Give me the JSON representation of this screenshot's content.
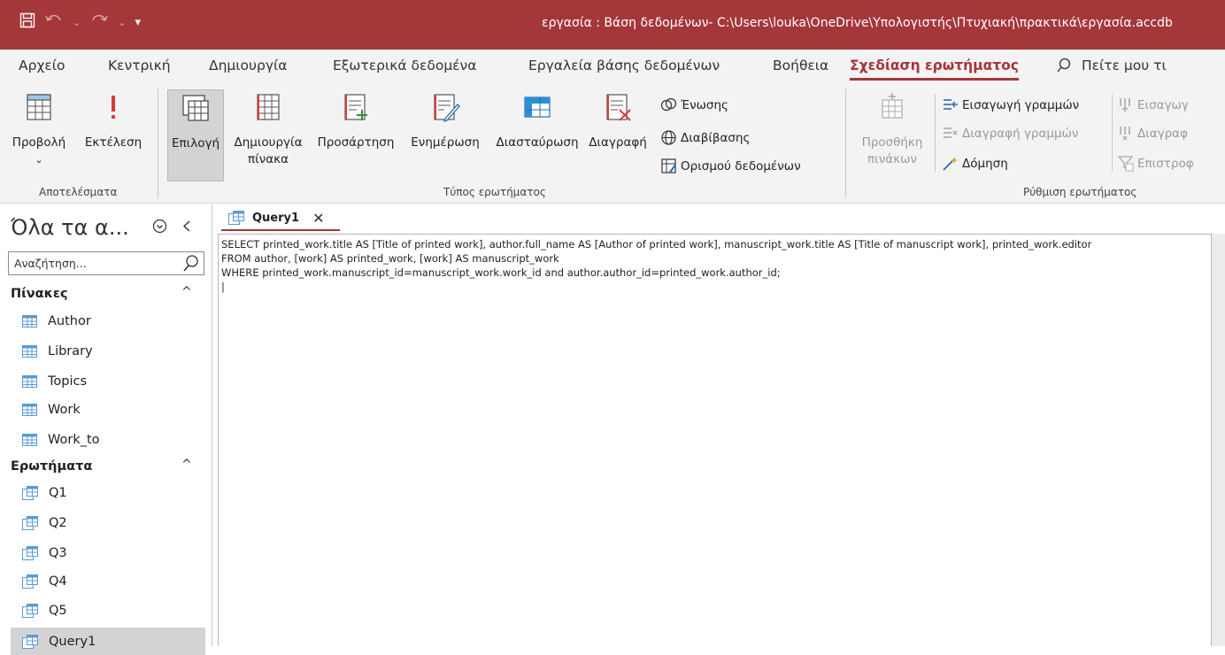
{
  "titlebar": {
    "title": "εργασία : Βάση δεδομένων- C:\\Users\\louka\\OneDrive\\Υπολογιστής\\Πτυχιακή\\πρακτικά\\εργασία.accdb"
  },
  "tabs": [
    {
      "label": "Αρχείο"
    },
    {
      "label": "Κεντρική"
    },
    {
      "label": "Δημιουργία"
    },
    {
      "label": "Εξωτερικά δεδομένα"
    },
    {
      "label": "Εργαλεία βάσης δεδομένων"
    },
    {
      "label": "Βοήθεια"
    },
    {
      "label": "Σχεδίαση ερωτήματος"
    }
  ],
  "tellme": "Πείτε μου τι",
  "ribbon": {
    "results": {
      "label": "Αποτελέσματα",
      "view": "Προβολή",
      "run": "Εκτέλεση"
    },
    "query_type": {
      "label": "Τύπος ερωτήματος",
      "select": "Επιλογή",
      "make_table_1": "Δημιουργία",
      "make_table_2": "πίνακα",
      "append": "Προσάρτηση",
      "update": "Ενημέρωση",
      "crosstab": "Διασταύρωση",
      "delete": "Διαγραφή",
      "union": "Ένωσης",
      "passthrough": "Διαβίβασης",
      "data_definition": "Ορισμού δεδομένων"
    },
    "query_setup": {
      "label": "Ρύθμιση ερωτήματος",
      "add_tables_1": "Προσθήκη",
      "add_tables_2": "πινάκων",
      "insert_rows": "Εισαγωγή γραμμών",
      "delete_rows": "Διαγραφή γραμμών",
      "builder": "Δόμηση",
      "insert_cols": "Εισαγωγ",
      "delete_cols": "Διαγραφ",
      "return": "Επιστροφ"
    }
  },
  "nav": {
    "header": "Όλα τα α...",
    "search_placeholder": "Αναζήτηση...",
    "tables_section": "Πίνακες",
    "tables": [
      {
        "label": "Author"
      },
      {
        "label": "Library"
      },
      {
        "label": "Topics"
      },
      {
        "label": "Work"
      },
      {
        "label": "Work_to"
      }
    ],
    "queries_section": "Ερωτήματα",
    "queries": [
      {
        "label": "Q1"
      },
      {
        "label": "Q2"
      },
      {
        "label": "Q3"
      },
      {
        "label": "Q4"
      },
      {
        "label": "Q5"
      },
      {
        "label": "Query1"
      }
    ]
  },
  "document": {
    "tab_label": "Query1",
    "sql": "SELECT printed_work.title AS [Title of printed work], author.full_name AS [Author of printed work], manuscript_work.title AS [Title of manuscript work], printed_work.editor\nFROM author, [work] AS printed_work, [work] AS manuscript_work\nWHERE printed_work.manuscript_id=manuscript_work.work_id and author.author_id=printed_work.author_id;\n|"
  },
  "colors": {
    "accent": "#a4373a",
    "ribbon_bg": "#f3f3f3",
    "selected_bg": "#d3d3d3"
  },
  "icons": [
    "save-icon",
    "undo-icon",
    "redo-icon",
    "customize-qat-icon",
    "table-icon",
    "query-icon",
    "search-icon",
    "chevron-down-circle-icon",
    "chevron-left-icon",
    "caret-up-icon",
    "close-icon"
  ]
}
